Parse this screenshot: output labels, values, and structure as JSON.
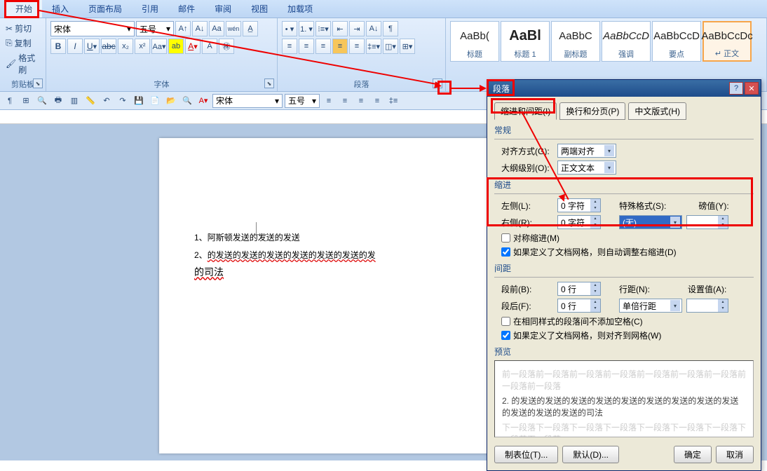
{
  "tabs": {
    "active": "开始",
    "items": [
      "开始",
      "插入",
      "页面布局",
      "引用",
      "邮件",
      "审阅",
      "视图",
      "加载项"
    ]
  },
  "clipboard": {
    "cut": "剪切",
    "copy": "复制",
    "paint": "格式刷",
    "title": "剪贴板"
  },
  "font": {
    "name": "宋体",
    "size": "五号",
    "title": "字体"
  },
  "paragraph": {
    "title": "段落"
  },
  "styles": [
    {
      "sample": "AaBb(",
      "name": "标题",
      "i": false
    },
    {
      "sample": "AaBl",
      "name": "标题 1",
      "i": false,
      "big": true
    },
    {
      "sample": "AaBbC",
      "name": "副标题",
      "i": false
    },
    {
      "sample": "AaBbCcD",
      "name": "强调",
      "i": true
    },
    {
      "sample": "AaBbCcD",
      "name": "要点",
      "i": false
    },
    {
      "sample": "AaBbCcDc",
      "name": "↵ 正文",
      "i": false,
      "sel": true
    }
  ],
  "qat_font": "宋体",
  "qat_size": "五号",
  "doc": {
    "line1_num": "1、",
    "line1_text": "阿斯顿发送的发送的发送",
    "line2_num": "2、",
    "line2_text": "的发送的发送的发送的发送的发送的发送的发",
    "line3": "的司法"
  },
  "dialog": {
    "title": "段落",
    "tabs": [
      "缩进和间距(I)",
      "换行和分页(P)",
      "中文版式(H)"
    ],
    "section_general": "常规",
    "align_label": "对齐方式(G):",
    "align_value": "两端对齐",
    "outline_label": "大纲级别(O):",
    "outline_value": "正文文本",
    "section_indent": "缩进",
    "left_label": "左侧(L):",
    "left_value": "0 字符",
    "right_label": "右侧(R):",
    "right_value": "0 字符",
    "special_label": "特殊格式(S):",
    "special_value": "(无)",
    "by_label": "磅值(Y):",
    "by_value": "",
    "mirror": "对称缩进(M)",
    "auto_indent": "如果定义了文档网格，则自动调整右缩进(D)",
    "section_spacing": "间距",
    "before_label": "段前(B):",
    "before_value": "0 行",
    "after_label": "段后(F):",
    "after_value": "0 行",
    "linespace_label": "行距(N):",
    "linespace_value": "单倍行距",
    "at_label": "设置值(A):",
    "at_value": "",
    "no_space": "在相同样式的段落间不添加空格(C)",
    "snap_grid": "如果定义了文档网格，则对齐到网格(W)",
    "section_preview": "预览",
    "preview_text": "2. 的发送的发送的发送的发送的发送的发送的发送的发送的发送的发送的发送的发送的司法",
    "tabs_btn": "制表位(T)...",
    "default_btn": "默认(D)...",
    "ok_btn": "确定",
    "cancel_btn": "取消"
  }
}
